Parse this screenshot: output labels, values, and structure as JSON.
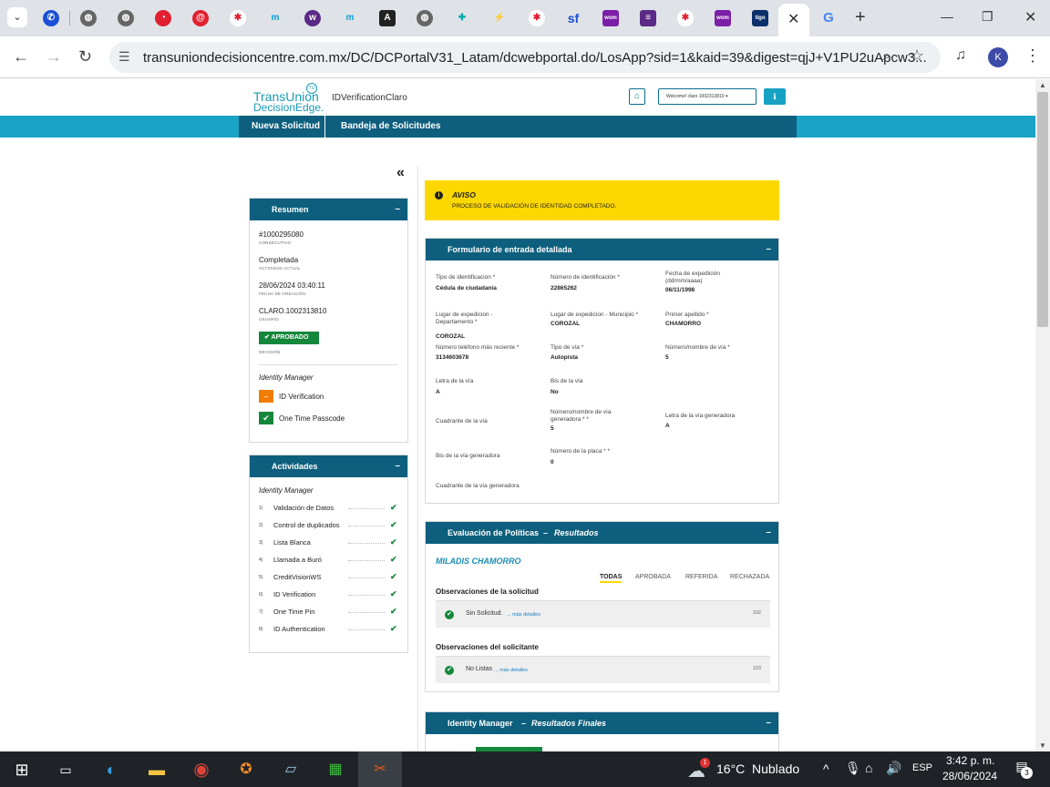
{
  "browser": {
    "tab_dropdown_icon": "chevron-down-icon",
    "active_tab_close": "✕",
    "google_tab_glyph": "G",
    "new_tab": "+",
    "url": "transuniondecisioncentre.com.mx/DC/DCPortalV31_Latam/dcwebportal.do/LosApp?sid=1&kaid=39&digest=qjJ+V1PU2uApcw3...",
    "profile_initial": "K",
    "tab_glyphs": {
      "sf": "sf",
      "wom": "wom",
      "tigo": "tigo",
      "angular": "A"
    }
  },
  "header": {
    "logo_line1": "TransUnion",
    "logo_line2": "DecisionEdge.",
    "logo_badge": "TU",
    "app_name": "IDVerificationClaro",
    "user_menu": "Welcome! claro 1002313810 ▾"
  },
  "nav": {
    "items": [
      "Nueva Solicitud",
      "Bandeja de Solicitudes"
    ]
  },
  "collapse_glyph": "«",
  "resumen": {
    "title": "Resumen",
    "collapse": "–",
    "consecutivo": "#1000295080",
    "consecutivo_label": "CONSECUTIVO",
    "actividad": "Completada",
    "actividad_label": "ACTIVIDAD ACTUAL",
    "fecha": "28/06/2024 03:40:11",
    "fecha_label": "FECHA DE CREACIÓN",
    "usuario": "CLARO.1002313810",
    "usuario_label": "USUARIO",
    "decision": "✔ APROBADO",
    "decision_label": "DECISIÓN",
    "idm_title": "Identity Manager",
    "items": [
      {
        "status": "–",
        "label": "ID Verification",
        "color": "#f07d00"
      },
      {
        "status": "✔",
        "label": "One Time Passcode",
        "color": "#15873b"
      }
    ]
  },
  "actividades": {
    "title": "Actividades",
    "collapse": "–",
    "idm_title": "Identity Manager",
    "items": [
      {
        "num": "1)",
        "label": "Validación de Datos",
        "check": "✔"
      },
      {
        "num": "2)",
        "label": "Control de duplicados",
        "check": "✔"
      },
      {
        "num": "3)",
        "label": "Lista Blanca",
        "check": "✔"
      },
      {
        "num": "4)",
        "label": "Llamada a Buró",
        "check": "✔"
      },
      {
        "num": "5)",
        "label": "CreditVisionWS",
        "check": "✔"
      },
      {
        "num": "6)",
        "label": "ID Verification",
        "check": "✔"
      },
      {
        "num": "7)",
        "label": "One Time Pin",
        "check": "✔"
      },
      {
        "num": "8)",
        "label": "ID Authentication",
        "check": "✔"
      }
    ]
  },
  "aviso": {
    "icon": "i",
    "title": "AVISO",
    "message": "PROCESO DE VALIDACIÓN DE IDENTIDAD COMPLETADO."
  },
  "formulario": {
    "title": "Formulario de entrada detallada",
    "collapse": "–",
    "fields": [
      {
        "label": "Tipo de identificacion *",
        "value": "Cédula de ciudadanía"
      },
      {
        "label": "Número de identificación *",
        "value": "22865262"
      },
      {
        "label": "Fecha de expedición (dd/mm/aaaa)",
        "value": "06/11/1998"
      },
      {
        "label": "Lugar de expedicion - Departamento *",
        "value": "COROZAL"
      },
      {
        "label": "Lugar de expedicion - Municipio *",
        "value": "COROZAL"
      },
      {
        "label": "Primer apellido *",
        "value": "CHAMORRO"
      },
      {
        "label": "Número teléfono más reciente *",
        "value": "3134603678"
      },
      {
        "label": "Tipo de vía *",
        "value": "Autopista"
      },
      {
        "label": "Número/nombre de vía *",
        "value": "5"
      },
      {
        "label": "Letra de la vía",
        "value": "A"
      },
      {
        "label": "Bis de la vía",
        "value": "No"
      },
      {
        "label": "Cuadrante de la vía",
        "value": ""
      },
      {
        "label": "Número/nombre de vía generadora * *",
        "value": "5"
      },
      {
        "label": "Letra de la vía generadora",
        "value": "A"
      },
      {
        "label": "Bis de la vía generadora",
        "value": ""
      },
      {
        "label": "Número de la placa * *",
        "value": "0"
      },
      {
        "label": "Cuadrante de la vía generadora",
        "value": ""
      }
    ]
  },
  "politicas": {
    "title": "Evaluación de Políticas",
    "title_sep": "–",
    "subtitle": "Resultados",
    "collapse": "–",
    "person": "MILADIS CHAMORRO",
    "filters": [
      "TODAS",
      "APROBADA",
      "REFERIDA",
      "RECHAZADA"
    ],
    "obs_solicitud_title": "Observaciones de la solicitud",
    "obs_solicitud": {
      "check": "✔",
      "text": "Sin Solicitud.",
      "more": "... más detalles",
      "code": "102"
    },
    "obs_solicitante_title": "Observaciones del solicitante",
    "obs_solicitante": {
      "check": "✔",
      "text": "No Listas",
      "more": "... más detalles",
      "code": "103"
    }
  },
  "idm_final": {
    "title": "Identity Manager",
    "title_sep": "–",
    "subtitle": "Resultados Finales",
    "collapse": "–"
  },
  "taskbar": {
    "weather_badge": "1",
    "weather_temp": "16°C",
    "weather_text": "Nublado",
    "tray_chevron": "^",
    "lang": "ESP",
    "time": "3:42 p. m.",
    "date": "28/06/2024",
    "notifications": "3"
  }
}
